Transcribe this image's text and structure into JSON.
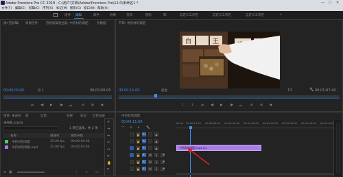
{
  "title_bar": {
    "title": "Adobe Premiere Pro CC 2018 - C:\\用户\\文档\\Adobe\\Premiere Pro\\12.0\\未命名1 *",
    "minimize": "—",
    "maximize": "☐",
    "close": "✕"
  },
  "menu": [
    "文件(F)",
    "编辑(E)",
    "剪辑(C)",
    "序列(S)",
    "标记(M)",
    "图形(G)",
    "窗口(W)",
    "帮助(H)"
  ],
  "workspaces": [
    "组件",
    "编辑",
    "颜色",
    "效果",
    "音频",
    "图形",
    "库",
    "自定义工作区",
    "自定义工作区",
    "自定义工作区"
  ],
  "active_workspace": "编辑",
  "source_panel": {
    "tabs": [
      "源:(无剪辑)",
      "效果控件",
      "音频剪辑混合器: 中药材的调配",
      "元数据"
    ],
    "timecode_left": "00;00;00;00",
    "timecode_right": "00;00;00;00",
    "page": "页 1"
  },
  "program_panel": {
    "tab": "节目: 中药材的调配",
    "timecode_left": "00:00:11:00",
    "fit": "适合",
    "quality": "1/2",
    "timecode_right": "00:01:07:40"
  },
  "project_panel": {
    "tabs": [
      "项目: 未命名",
      "库",
      "信息",
      "效果",
      "标记",
      "历史记录"
    ],
    "file": "未命名.prproj",
    "item_count": "1 项已选择，共 2 项",
    "columns": [
      "名称",
      "帧速率",
      "媒体开始"
    ],
    "items": [
      {
        "name": "中药材的调配",
        "fps": "25.00 fps",
        "start": "00:00:00:00",
        "color": "#4ccd5c"
      },
      {
        "name": "中药材的调配.mp4",
        "fps": "25.00 fps",
        "start": "00:00:00:00",
        "color": "#a77be0"
      }
    ]
  },
  "timeline": {
    "tab": "中药材的调配",
    "timecode": "00:00:11:00",
    "ruler": [
      "00:00",
      "00:00:15:00",
      "00:00:30:00",
      "00:00:45:00",
      "00:01:00:00",
      "00:01:15:00",
      "00:01:30:00",
      "00:01:45:00",
      "00:02:00:00"
    ],
    "tracks": [
      "V3",
      "V2",
      "V1",
      "A1",
      "A2",
      "A3"
    ],
    "clip_name": "中药材的调配.mp4 [V]",
    "clip_color": "#a97ee6",
    "arrow_color": "#e02020"
  }
}
